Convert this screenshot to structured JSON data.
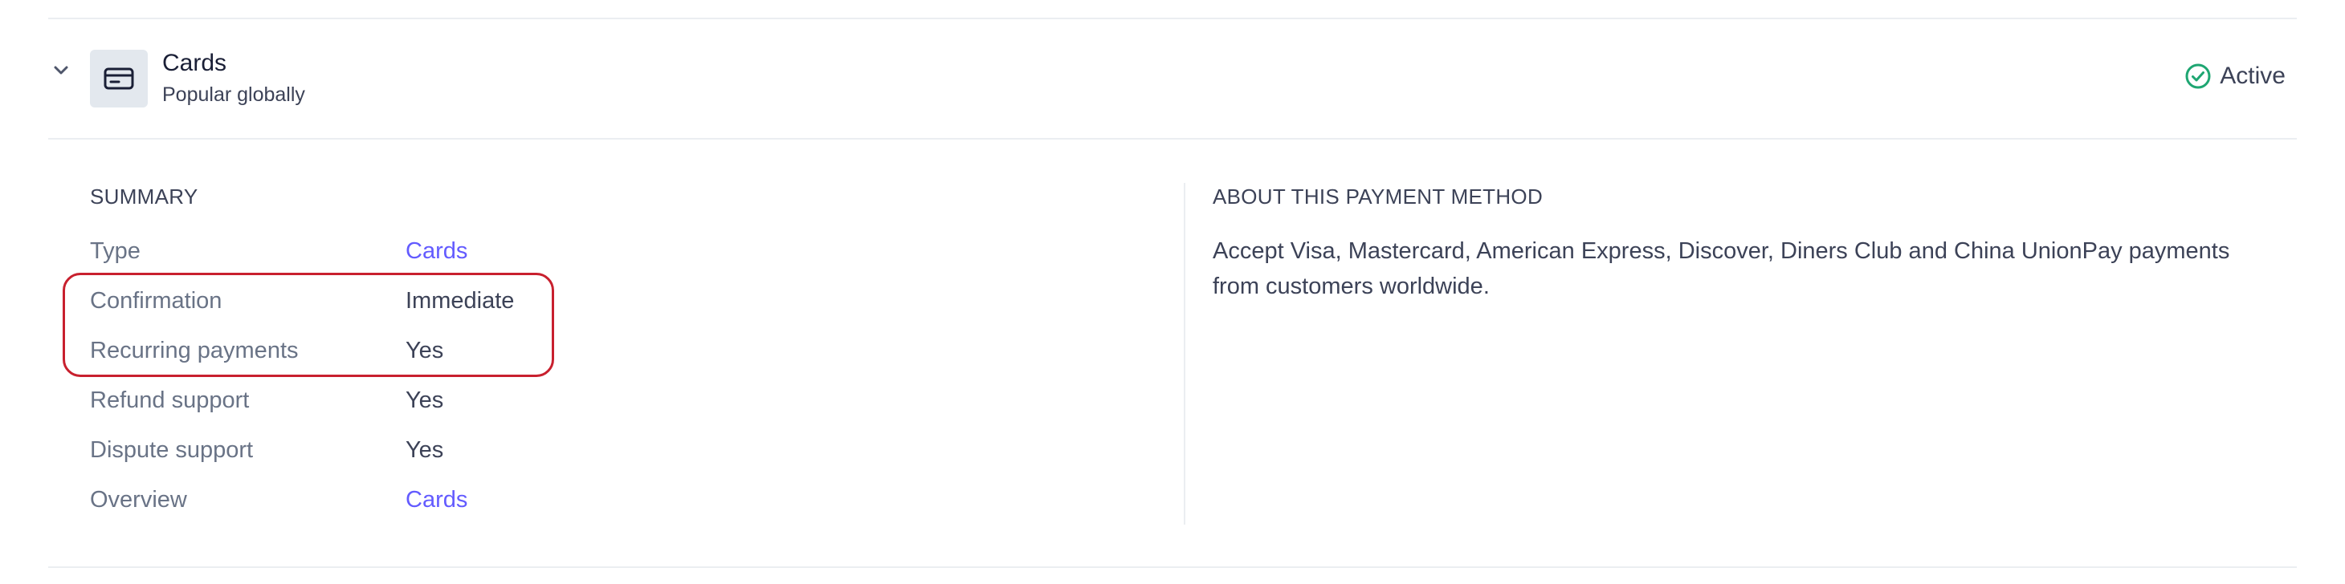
{
  "header": {
    "title": "Cards",
    "subtitle": "Popular globally",
    "status": "Active",
    "status_color": "#1ea672",
    "icon": "credit-card-icon",
    "expand_icon": "chevron-down-icon"
  },
  "summary": {
    "title": "SUMMARY",
    "rows": [
      {
        "label": "Type",
        "value": "Cards",
        "is_link": true
      },
      {
        "label": "Confirmation",
        "value": "Immediate",
        "is_link": false
      },
      {
        "label": "Recurring payments",
        "value": "Yes",
        "is_link": false
      },
      {
        "label": "Refund support",
        "value": "Yes",
        "is_link": false
      },
      {
        "label": "Dispute support",
        "value": "Yes",
        "is_link": false
      },
      {
        "label": "Overview",
        "value": "Cards",
        "is_link": true
      }
    ]
  },
  "about": {
    "title": "ABOUT THIS PAYMENT METHOD",
    "description": "Accept Visa, Mastercard, American Express, Discover, Diners Club and China UnionPay payments from customers worldwide."
  },
  "colors": {
    "link": "#635bff",
    "annotation": "#c8202e"
  }
}
